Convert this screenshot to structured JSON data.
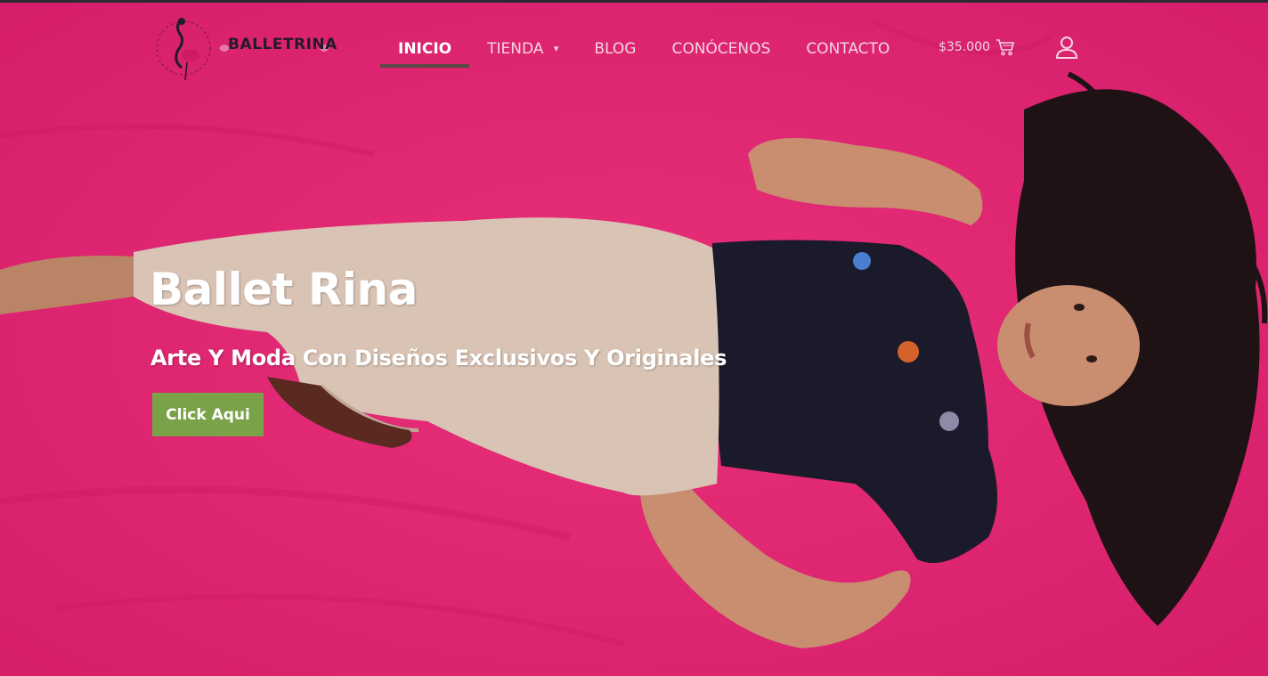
{
  "brand": {
    "logo_text": "BALLETRINA"
  },
  "nav": {
    "items": [
      {
        "label": "INICIO",
        "active": true
      },
      {
        "label": "TIENDA",
        "has_dropdown": true
      },
      {
        "label": "BLOG"
      },
      {
        "label": "CONÓCENOS"
      },
      {
        "label": "CONTACTO"
      }
    ]
  },
  "cart": {
    "amount": "$35.000",
    "icon": "cart-icon"
  },
  "account": {
    "icon": "user-icon"
  },
  "hero": {
    "title": "Ballet Rina",
    "subtitle": "Arte Y Moda Con Diseños Exclusivos Y Originales",
    "cta_label": "Click Aqui"
  },
  "colors": {
    "hero_pink": "#e0246f",
    "cta_green": "#7aa349",
    "nav_text": "#f2d6e2",
    "active_underline": "#5a4a44"
  }
}
